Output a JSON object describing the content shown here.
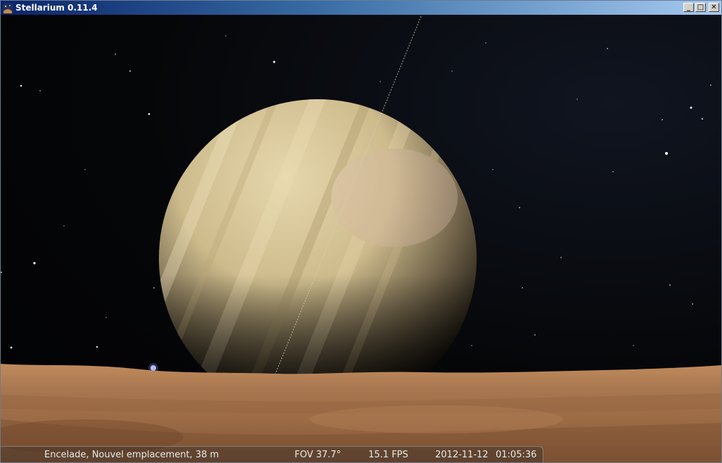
{
  "window": {
    "title": "Stellarium 0.11.4",
    "buttons": {
      "minimize_icon": "minimize-icon",
      "maximize_icon": "maximize-icon",
      "close_icon": "close-icon",
      "minimize_glyph": "_",
      "maximize_glyph": "□",
      "close_glyph": "✕"
    }
  },
  "status_bar": {
    "location": "Encelade, Nouvel emplacement, 38 m",
    "fov": "FOV 37.7°",
    "fps": "15.1 FPS",
    "date": "2012-11-12",
    "time": "01:05:36"
  },
  "colors": {
    "titlebar_start": "#0a246a",
    "titlebar_end": "#a6caf0",
    "ground": "#a8764a",
    "planet": "#d8c79a",
    "status_text": "#e8e8e8"
  }
}
